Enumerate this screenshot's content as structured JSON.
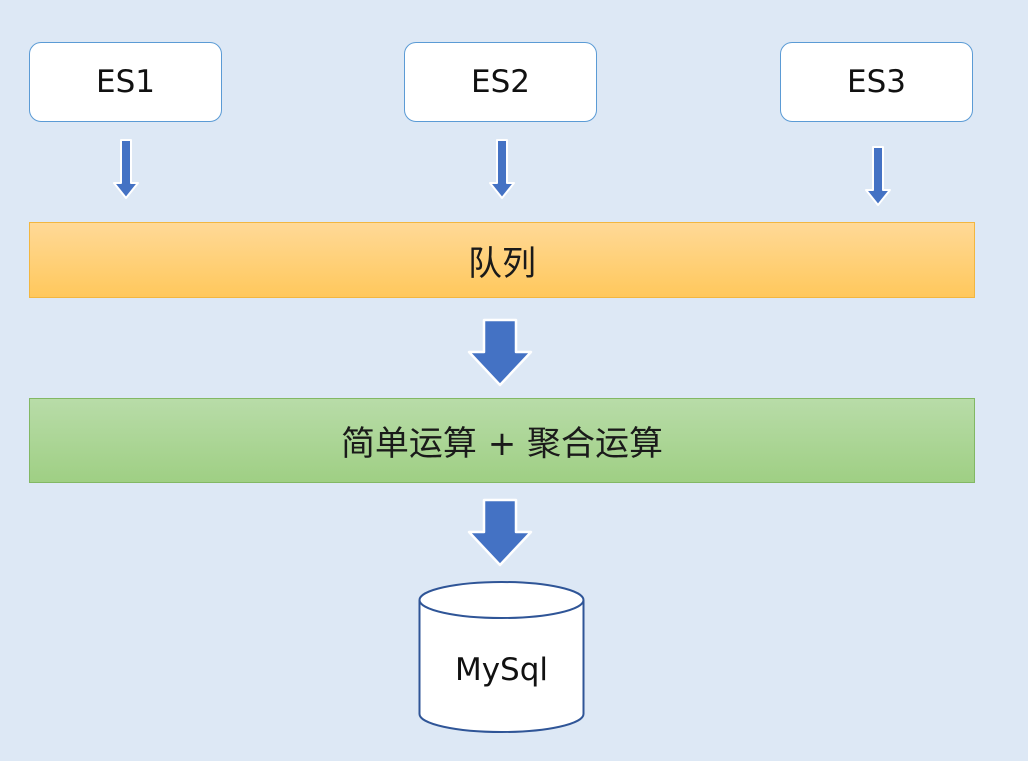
{
  "sources": [
    {
      "label": "ES1"
    },
    {
      "label": "ES2"
    },
    {
      "label": "ES3"
    }
  ],
  "queue": {
    "label": "队列"
  },
  "compute": {
    "label": "简单运算 + 聚合运算"
  },
  "database": {
    "label": "MySql"
  },
  "colors": {
    "background": "#dde8f5",
    "source_border": "#5b9bd5",
    "arrow_fill": "#4472c4",
    "queue_fill": "#ffd27a",
    "compute_fill": "#a9d18e"
  }
}
